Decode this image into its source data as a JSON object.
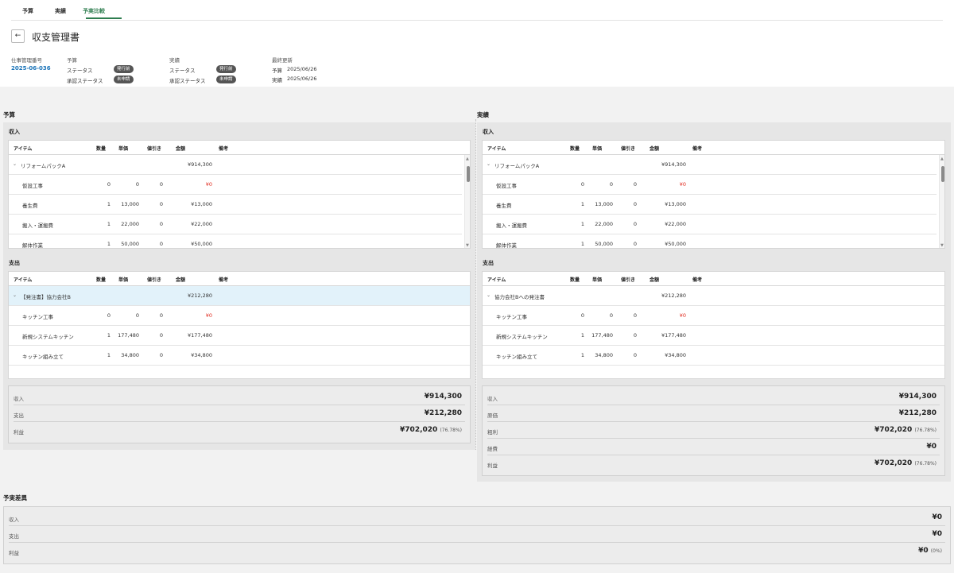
{
  "tabs": [
    "予算",
    "実績",
    "予実比較"
  ],
  "header": {
    "title": "収支管理書",
    "back_icon": "←"
  },
  "meta": {
    "job_no_label": "仕事管理番号",
    "job_no": "2025-06-036",
    "budget_heading": "予算",
    "actual_heading": "実績",
    "status_label": "ステータス",
    "approval_label": "承認ステータス",
    "budget_status": "発行前",
    "budget_approval": "未申請",
    "actual_status": "発行前",
    "actual_approval": "未申請",
    "updated_label": "最終更新",
    "updated_budget_label": "予算",
    "updated_budget": "2025/06/26",
    "updated_actual_label": "実績",
    "updated_actual": "2025/06/26"
  },
  "columns": [
    "アイテム",
    "数量",
    "単価",
    "値引き",
    "金額",
    "備考"
  ],
  "budget": {
    "title": "予算",
    "income_title": "収入",
    "expense_title": "支出",
    "income_rows": [
      {
        "item": "リフォームパックA",
        "qty": "",
        "price": "",
        "discount": "",
        "amount": "¥914,300",
        "group": true
      },
      {
        "item": "仮設工事",
        "qty": "0",
        "price": "0",
        "discount": "0",
        "amount": "¥0",
        "red": true
      },
      {
        "item": "養生費",
        "qty": "1",
        "price": "13,000",
        "discount": "0",
        "amount": "¥13,000"
      },
      {
        "item": "搬入・運搬費",
        "qty": "1",
        "price": "22,000",
        "discount": "0",
        "amount": "¥22,000"
      },
      {
        "item": "解体作業",
        "qty": "1",
        "price": "50,000",
        "discount": "0",
        "amount": "¥50,000"
      }
    ],
    "expense_rows": [
      {
        "item": "【発注書】協力会社B",
        "qty": "",
        "price": "",
        "discount": "",
        "amount": "¥212,280",
        "group": true
      },
      {
        "item": "キッチン工事",
        "qty": "0",
        "price": "0",
        "discount": "0",
        "amount": "¥0",
        "red": true
      },
      {
        "item": "新規システムキッチン",
        "qty": "1",
        "price": "177,480",
        "discount": "0",
        "amount": "¥177,480"
      },
      {
        "item": "キッチン組み立て",
        "qty": "1",
        "price": "34,800",
        "discount": "0",
        "amount": "¥34,800"
      }
    ],
    "summary": [
      {
        "label": "収入",
        "value": "¥914,300",
        "pct": ""
      },
      {
        "label": "支出",
        "value": "¥212,280",
        "pct": ""
      },
      {
        "label": "利益",
        "value": "¥702,020",
        "pct": "(76.78%)"
      }
    ]
  },
  "actual": {
    "title": "実績",
    "income_title": "収入",
    "expense_title": "支出",
    "income_rows": [
      {
        "item": "リフォームパックA",
        "qty": "",
        "price": "",
        "discount": "",
        "amount": "¥914,300",
        "group": true
      },
      {
        "item": "仮設工事",
        "qty": "0",
        "price": "0",
        "discount": "0",
        "amount": "¥0",
        "red": true
      },
      {
        "item": "養生費",
        "qty": "1",
        "price": "13,000",
        "discount": "0",
        "amount": "¥13,000"
      },
      {
        "item": "搬入・運搬費",
        "qty": "1",
        "price": "22,000",
        "discount": "0",
        "amount": "¥22,000"
      },
      {
        "item": "解体作業",
        "qty": "1",
        "price": "50,000",
        "discount": "0",
        "amount": "¥50,000"
      }
    ],
    "expense_rows": [
      {
        "item": "協力会社Bへの発注書",
        "qty": "",
        "price": "",
        "discount": "",
        "amount": "¥212,280",
        "group": true
      },
      {
        "item": "キッチン工事",
        "qty": "0",
        "price": "0",
        "discount": "0",
        "amount": "¥0",
        "red": true
      },
      {
        "item": "新規システムキッチン",
        "qty": "1",
        "price": "177,480",
        "discount": "0",
        "amount": "¥177,480"
      },
      {
        "item": "キッチン組み立て",
        "qty": "1",
        "price": "34,800",
        "discount": "0",
        "amount": "¥34,800"
      }
    ],
    "summary": [
      {
        "label": "収入",
        "value": "¥914,300",
        "pct": ""
      },
      {
        "label": "原価",
        "value": "¥212,280",
        "pct": ""
      },
      {
        "label": "粗利",
        "value": "¥702,020",
        "pct": "(76.78%)"
      },
      {
        "label": "経費",
        "value": "¥0",
        "pct": ""
      },
      {
        "label": "利益",
        "value": "¥702,020",
        "pct": "(76.78%)"
      }
    ]
  },
  "variance": {
    "title": "予実差異",
    "rows": [
      {
        "label": "収入",
        "value": "¥0",
        "pct": ""
      },
      {
        "label": "支出",
        "value": "¥0",
        "pct": ""
      },
      {
        "label": "利益",
        "value": "¥0",
        "pct": "(0%)"
      }
    ]
  },
  "colors": {
    "accent": "#2e7d4f",
    "link": "#1a73b8",
    "negative": "#e0271b",
    "highlight_row": "#e2f2fa"
  }
}
